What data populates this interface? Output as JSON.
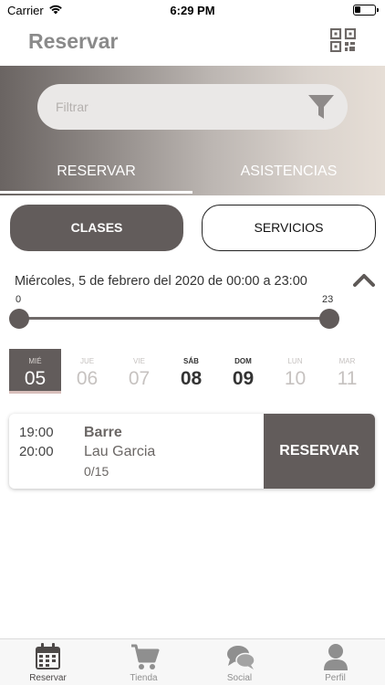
{
  "status_bar": {
    "carrier": "Carrier",
    "time": "6:29 PM"
  },
  "header": {
    "title": "Reservar"
  },
  "filter": {
    "placeholder": "Filtrar"
  },
  "tabs": [
    {
      "label": "RESERVAR",
      "active": true
    },
    {
      "label": "ASISTENCIAS",
      "active": false
    }
  ],
  "segments": [
    {
      "label": "CLASES",
      "selected": true
    },
    {
      "label": "SERVICIOS",
      "selected": false
    }
  ],
  "date_range": {
    "text": "Miércoles, 5 de febrero del 2020 de 00:00 a 23:00",
    "min_label": "0",
    "max_label": "23",
    "slider_low": 0,
    "slider_high": 23
  },
  "days": [
    {
      "dow": "MIÉ",
      "num": "05",
      "selected": true,
      "weekend": false
    },
    {
      "dow": "JUE",
      "num": "06",
      "selected": false,
      "weekend": false
    },
    {
      "dow": "VIE",
      "num": "07",
      "selected": false,
      "weekend": false
    },
    {
      "dow": "SÁB",
      "num": "08",
      "selected": false,
      "weekend": true
    },
    {
      "dow": "DOM",
      "num": "09",
      "selected": false,
      "weekend": true
    },
    {
      "dow": "LUN",
      "num": "10",
      "selected": false,
      "weekend": false
    },
    {
      "dow": "MAR",
      "num": "11",
      "selected": false,
      "weekend": false
    }
  ],
  "classes": [
    {
      "start": "19:00",
      "end": "20:00",
      "name": "Barre",
      "instructor": "Lau Garcia",
      "spots": "0/15",
      "action": "RESERVAR"
    }
  ],
  "tabbar": [
    {
      "label": "Reservar",
      "icon": "calendar-icon",
      "active": true
    },
    {
      "label": "Tienda",
      "icon": "cart-icon",
      "active": false
    },
    {
      "label": "Social",
      "icon": "chat-bubbles-icon",
      "active": false
    },
    {
      "label": "Perfil",
      "icon": "person-icon",
      "active": false
    }
  ],
  "colors": {
    "accent": "#625c5b",
    "title_gray": "#8a8a8a"
  }
}
